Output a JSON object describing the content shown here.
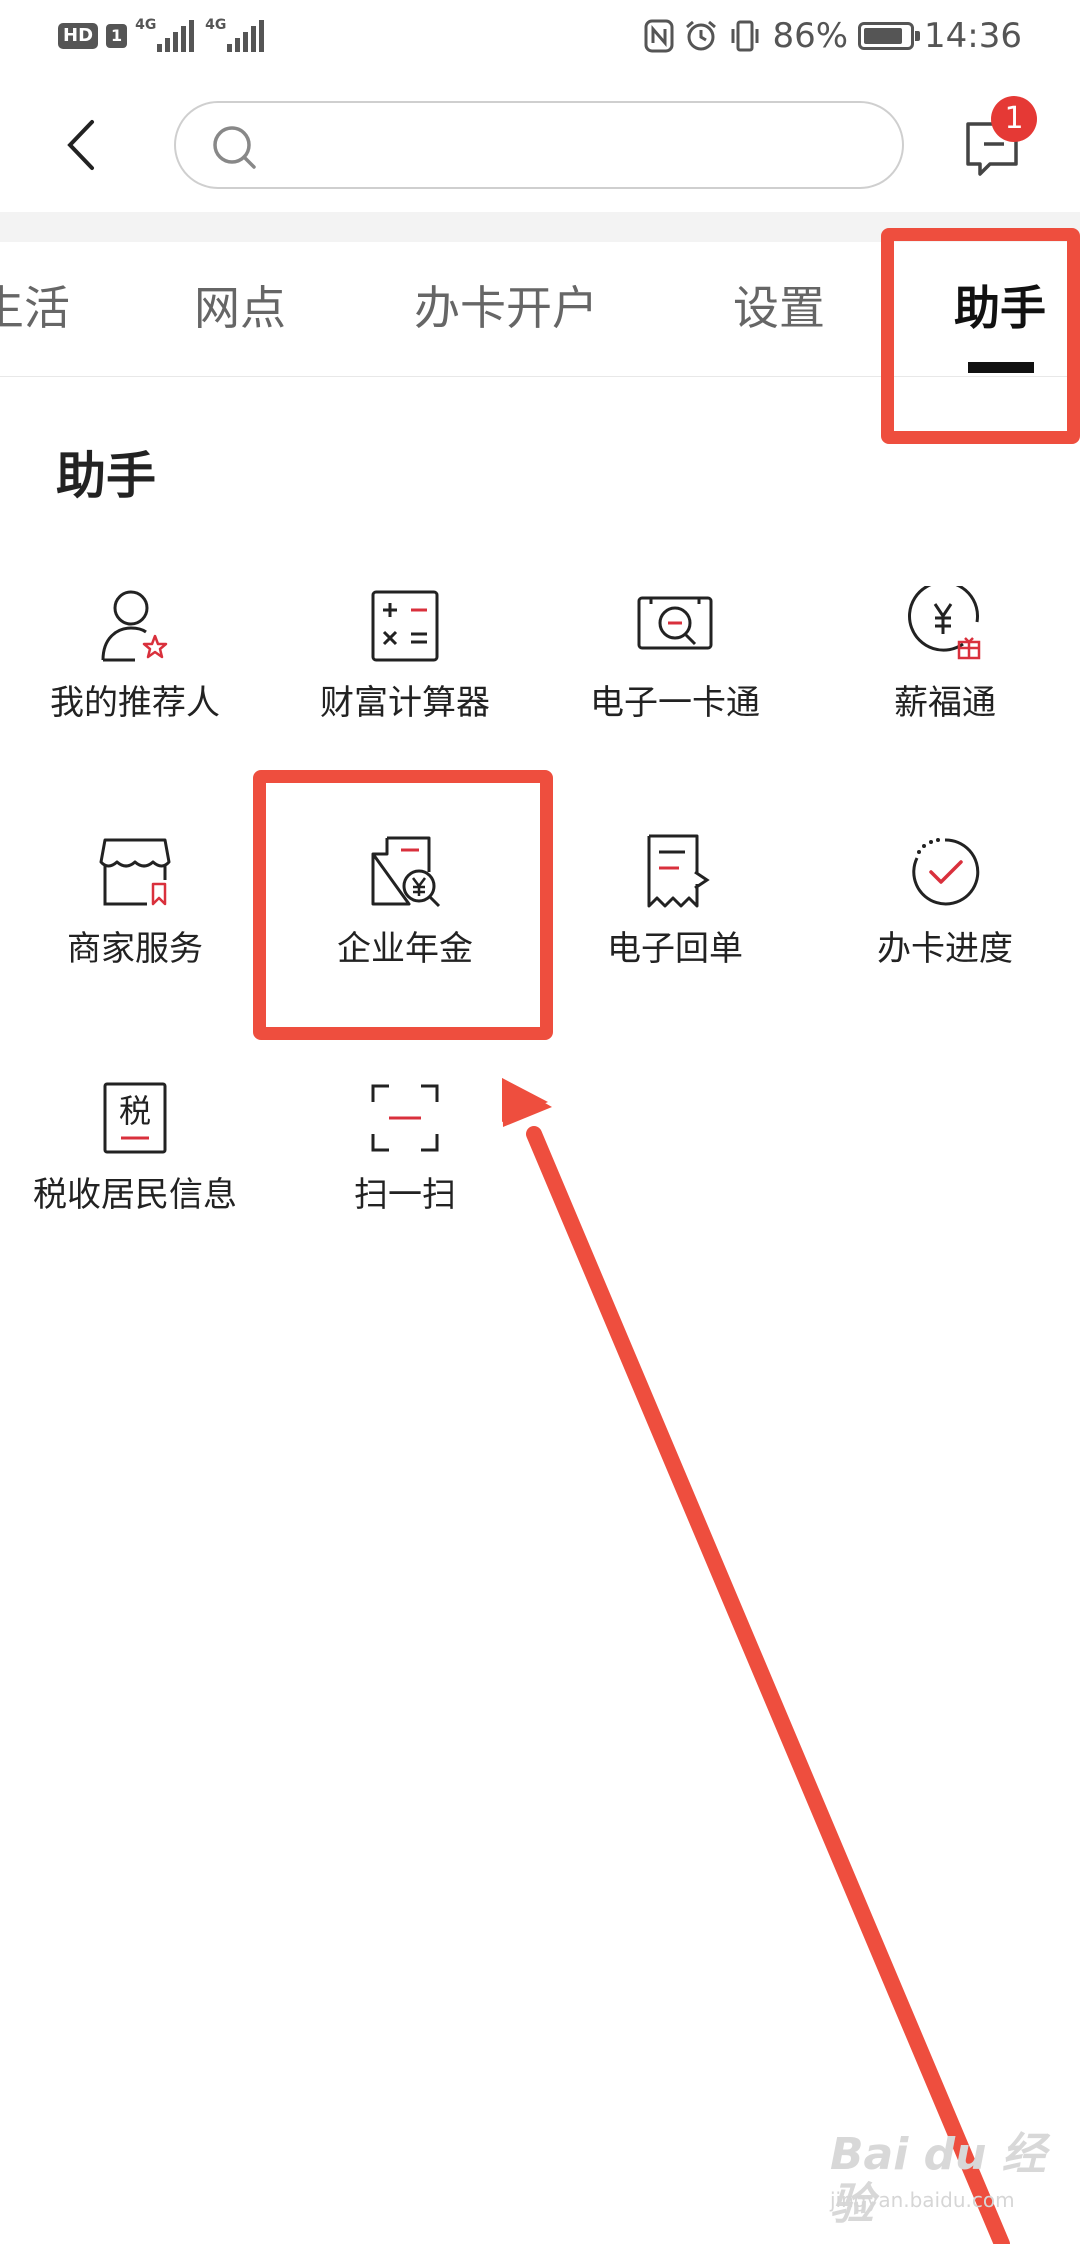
{
  "status_bar": {
    "hd": "HD",
    "sim": "1",
    "net1": "4G",
    "net2": "4G",
    "battery_percent": "86%",
    "battery_level": 0.86,
    "time": "14:36"
  },
  "header": {
    "search_placeholder": "",
    "message_badge": "1"
  },
  "tabs": [
    {
      "label": "生活"
    },
    {
      "label": "网点"
    },
    {
      "label": "办卡开户"
    },
    {
      "label": "设置"
    },
    {
      "label": "助手",
      "active": true
    }
  ],
  "section": {
    "title": "助手"
  },
  "items": [
    {
      "label": "我的推荐人",
      "icon": "person-star-icon"
    },
    {
      "label": "财富计算器",
      "icon": "calculator-icon"
    },
    {
      "label": "电子一卡通",
      "icon": "e-card-icon"
    },
    {
      "label": "薪福通",
      "icon": "yuan-gift-icon"
    },
    {
      "label": "商家服务",
      "icon": "storefront-icon"
    },
    {
      "label": "企业年金",
      "icon": "document-yuan-search-icon"
    },
    {
      "label": "电子回单",
      "icon": "receipt-icon"
    },
    {
      "label": "办卡进度",
      "icon": "progress-check-icon"
    },
    {
      "label": "税收居民信息",
      "icon": "tax-icon",
      "icon_text": "税"
    },
    {
      "label": "扫一扫",
      "icon": "scan-icon"
    }
  ],
  "watermark": {
    "text": "Bai du 经验",
    "sub": "jingyan.baidu.com"
  },
  "colors": {
    "accent_red": "#d9303c",
    "annotation_red": "#ee4e3e",
    "icon_dark": "#222222"
  }
}
